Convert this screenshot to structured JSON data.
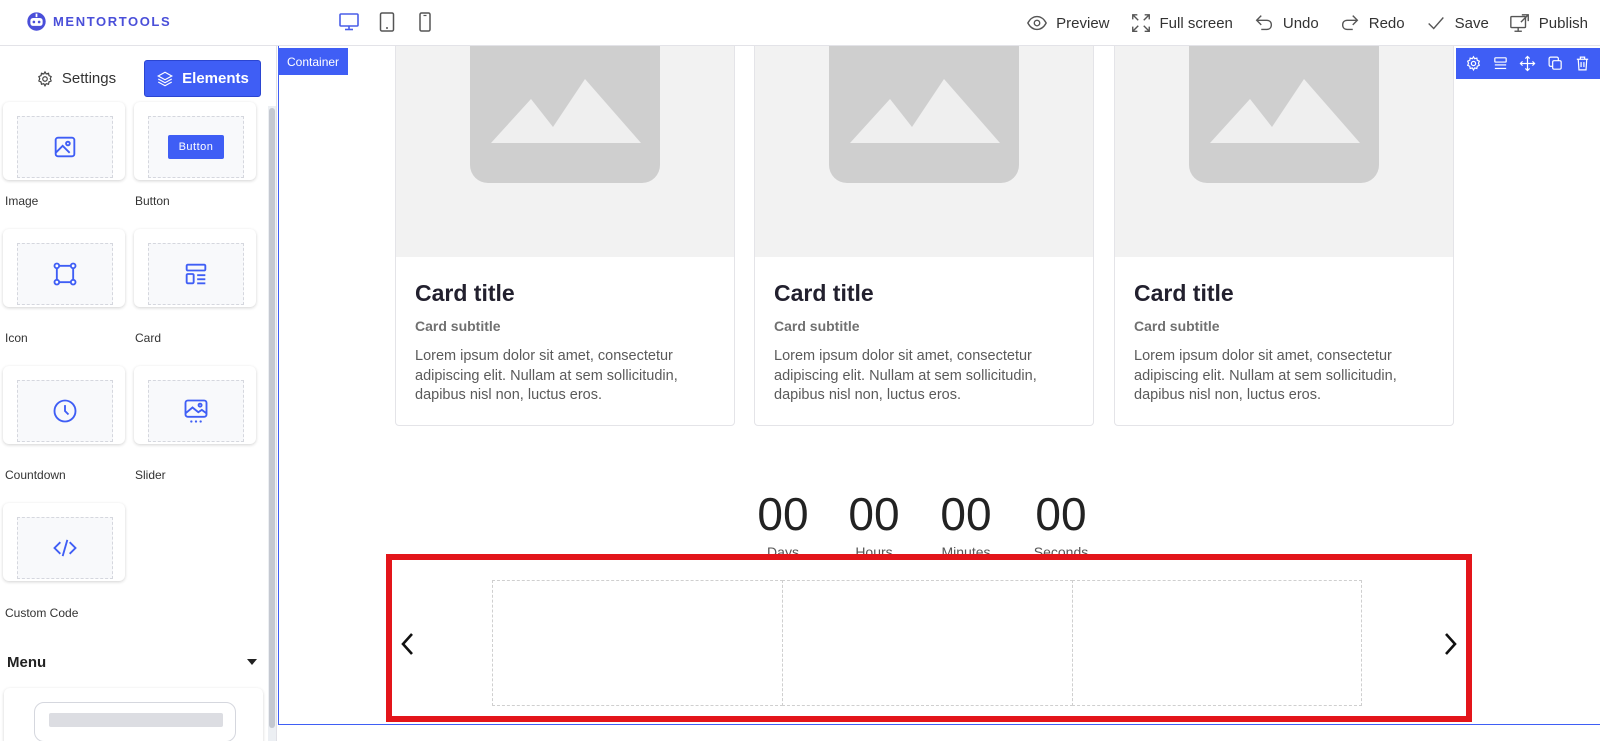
{
  "brand": {
    "name": "MENTORTOOLS",
    "accent": "#3f5ef5"
  },
  "devices": [
    "desktop-icon",
    "tablet-icon",
    "mobile-icon"
  ],
  "actions": [
    {
      "label": "Preview",
      "icon": "eye-icon"
    },
    {
      "label": "Full screen",
      "icon": "fullscreen-icon"
    },
    {
      "label": "Undo",
      "icon": "undo-icon"
    },
    {
      "label": "Redo",
      "icon": "redo-icon"
    },
    {
      "label": "Save",
      "icon": "check-icon"
    },
    {
      "label": "Publish",
      "icon": "publish-icon"
    }
  ],
  "panel": {
    "tabs": {
      "settings": "Settings",
      "elements": "Elements"
    },
    "elements": [
      {
        "label": "Image",
        "icon": "image-icon"
      },
      {
        "label": "Button",
        "icon": "button-preview",
        "demo": "Button"
      },
      {
        "label": "Icon",
        "icon": "vector-square-icon"
      },
      {
        "label": "Card",
        "icon": "card-layout-icon"
      },
      {
        "label": "Countdown",
        "icon": "clock-icon"
      },
      {
        "label": "Slider",
        "icon": "slider-image-icon"
      },
      {
        "label": "Custom Code",
        "icon": "code-icon"
      }
    ],
    "menu": {
      "title": "Menu"
    }
  },
  "canvas": {
    "container_label": "Container",
    "container_tools": [
      "gear-icon",
      "align-icon",
      "move-icon",
      "duplicate-icon",
      "trash-icon"
    ],
    "cards": [
      {
        "title": "Card title",
        "subtitle": "Card subtitle",
        "text": "Lorem ipsum dolor sit amet, consectetur adipiscing elit. Nullam at sem sollicitudin, dapibus nisl non, luctus eros."
      },
      {
        "title": "Card title",
        "subtitle": "Card subtitle",
        "text": "Lorem ipsum dolor sit amet, consectetur adipiscing elit. Nullam at sem sollicitudin, dapibus nisl non, luctus eros."
      },
      {
        "title": "Card title",
        "subtitle": "Card subtitle",
        "text": "Lorem ipsum dolor sit amet, consectetur adipiscing elit. Nullam at sem sollicitudin, dapibus nisl non, luctus eros."
      }
    ],
    "countdown": [
      {
        "value": "00",
        "label": "Days"
      },
      {
        "value": "00",
        "label": "Hours"
      },
      {
        "value": "00",
        "label": "Minutes"
      },
      {
        "value": "00",
        "label": "Seconds"
      }
    ],
    "slider": {
      "slides": 3,
      "selection_color": "#e3151a"
    }
  }
}
